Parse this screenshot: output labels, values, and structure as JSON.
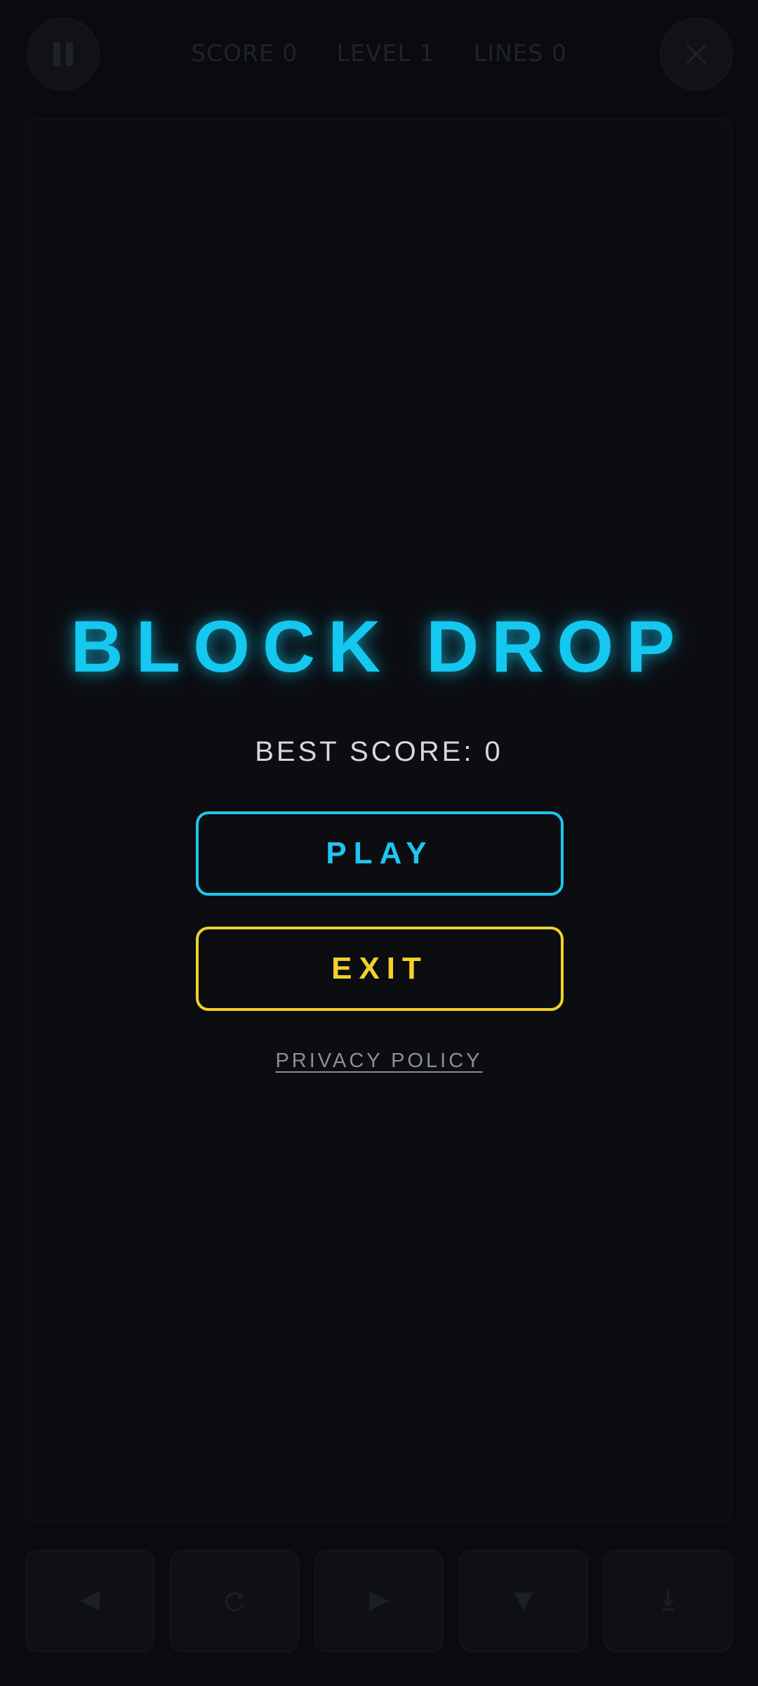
{
  "hud": {
    "score_label": "SCORE 0",
    "level_label": "LEVEL 1",
    "lines_label": "LINES 0",
    "pause_icon": "pause-icon",
    "close_icon": "close-icon"
  },
  "menu": {
    "title": "BLOCK DROP",
    "best_score": "BEST SCORE: 0",
    "play_label": "PLAY",
    "exit_label": "EXIT",
    "privacy_label": "PRIVACY POLICY"
  },
  "controls": [
    {
      "icon": "arrow-left-icon"
    },
    {
      "icon": "rotate-icon"
    },
    {
      "icon": "arrow-right-icon"
    },
    {
      "icon": "arrow-down-icon"
    },
    {
      "icon": "hard-drop-icon"
    }
  ],
  "colors": {
    "background": "#0a0b0e",
    "accent_cyan": "#1ec6ef",
    "accent_yellow": "#f2d12a",
    "text_light": "#d6d8de",
    "text_muted": "#8c8f96"
  }
}
